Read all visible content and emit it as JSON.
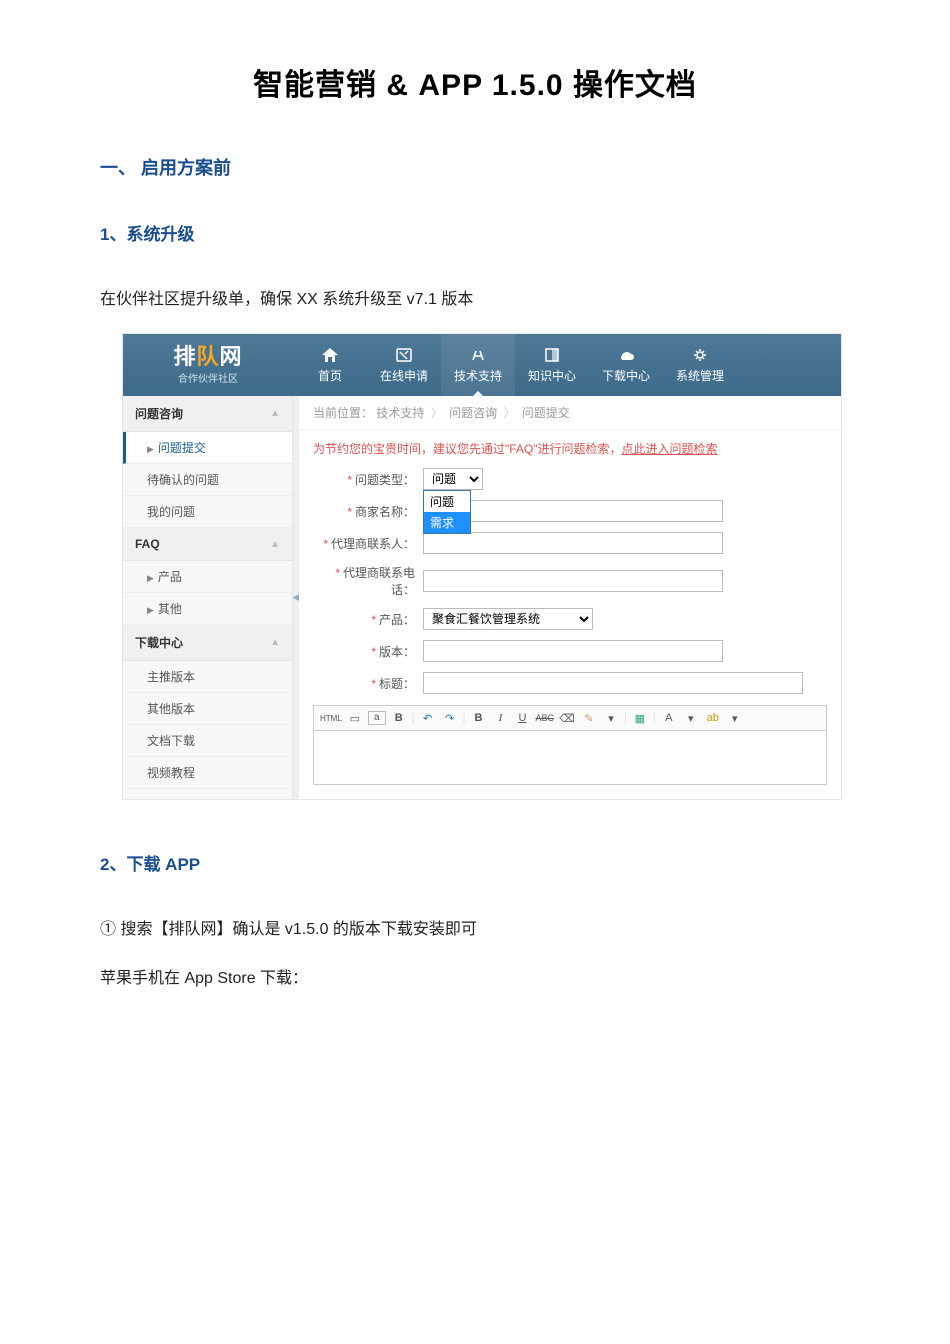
{
  "doc": {
    "title": "智能营销 & APP 1.5.0 操作文档",
    "sec1": "一、   启用方案前",
    "sub1": "1、系统升级",
    "para1": "在伙伴社区提升级单，确保 XX 系统升级至 v7.1 版本",
    "sub2": "2、下载 APP",
    "para2": "① 搜索【排队网】确认是 v1.5.0 的版本下载安装即可",
    "para3": "苹果手机在 App Store 下载："
  },
  "app": {
    "brand": {
      "name_prefix": "排",
      "name_mid": "队",
      "name_suffix": "网",
      "sub": "合作伙伴社区"
    },
    "nav": [
      {
        "label": "首页"
      },
      {
        "label": "在线申请"
      },
      {
        "label": "技术支持"
      },
      {
        "label": "知识中心"
      },
      {
        "label": "下载中心"
      },
      {
        "label": "系统管理"
      }
    ],
    "sidebar": {
      "g1": {
        "title": "问题咨询",
        "items": [
          "问题提交",
          "待确认的问题",
          "我的问题"
        ]
      },
      "g2": {
        "title": "FAQ",
        "items": [
          "产品",
          "其他"
        ]
      },
      "g3": {
        "title": "下载中心",
        "items": [
          "主推版本",
          "其他版本",
          "文档下载",
          "视频教程"
        ]
      }
    },
    "breadcrumb": {
      "label": "当前位置：",
      "p1": "技术支持",
      "p2": "问题咨询",
      "p3": "问题提交"
    },
    "tip": {
      "pre": "为节约您的宝贵时间，建议您先通过\"FAQ\"进行问题检索，",
      "link": "点此进入问题检索"
    },
    "form": {
      "type": {
        "label": "问题类型：",
        "selected": "问题",
        "opts": [
          "问题",
          "需求"
        ]
      },
      "merchant": {
        "label": "商家名称："
      },
      "contact": {
        "label": "代理商联系人："
      },
      "phone": {
        "label": "代理商联系电话："
      },
      "product": {
        "label": "产品：",
        "value": "聚食汇餐饮管理系统"
      },
      "version": {
        "label": "版本："
      },
      "title": {
        "label": "标题："
      }
    },
    "toolbar": {
      "html": "HTML",
      "src": "▭",
      "a": "a",
      "bigB": "B",
      "undo": "↶",
      "redo": "↷",
      "bold": "B",
      "italic": "I",
      "underline": "U",
      "strike": "ABC",
      "clear": "⌫",
      "format": "✎",
      "table": "▦",
      "font": "A",
      "more": "⋯"
    }
  }
}
